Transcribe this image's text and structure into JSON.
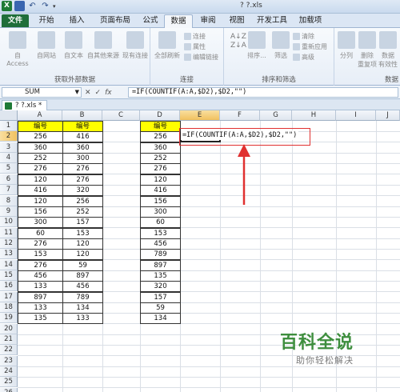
{
  "window": {
    "title": "? ?.xls"
  },
  "quick_access": {
    "logo": "X",
    "undo_glyph": "↶",
    "redo_glyph": "↷",
    "more_glyph": "▾"
  },
  "tabs": {
    "file": "文件",
    "items": [
      "开始",
      "插入",
      "页面布局",
      "公式",
      "数据",
      "审阅",
      "视图",
      "开发工具",
      "加载项"
    ],
    "active": "数据"
  },
  "ribbon": {
    "get_external": {
      "label": "获取外部数据",
      "buttons": [
        "自 Access",
        "自网站",
        "自文本",
        "自其他来源",
        "现有连接"
      ]
    },
    "connections": {
      "label": "连接",
      "refresh": "全部刷新",
      "small": [
        "连接",
        "属性",
        "编辑链接"
      ]
    },
    "sort_filter": {
      "label": "排序和筛选",
      "sort_az": "A↓Z\nZ↓A",
      "sort": "排序...",
      "filter": "筛选",
      "small": [
        "清除",
        "重新应用",
        "高级"
      ]
    },
    "data_tools": {
      "label": "数据",
      "buttons": [
        "分列",
        "删除\n重复项",
        "数据\n有效性"
      ]
    }
  },
  "formula_bar": {
    "name_box": "SUM",
    "name_drop": "▼",
    "controls": [
      "✕",
      "✓",
      "fx"
    ],
    "formula": "=IF(COUNTIF(A:A,$D2),$D2,\"\")"
  },
  "workbook_tab": {
    "label": "? ?.xls *"
  },
  "grid": {
    "columns": [
      "A",
      "B",
      "C",
      "D",
      "E",
      "F",
      "G",
      "H",
      "I",
      "J"
    ],
    "rows": [
      "1",
      "2",
      "3",
      "4",
      "5",
      "6",
      "7",
      "8",
      "9",
      "10",
      "11",
      "12",
      "13",
      "14",
      "15",
      "16",
      "17",
      "18",
      "19",
      "20",
      "21",
      "22",
      "23",
      "24",
      "25",
      "26"
    ],
    "header_a": "编号",
    "header_b": "编号",
    "header_d": "编号",
    "col_a": [
      "256",
      "360",
      "252",
      "276",
      "120",
      "416",
      "120",
      "156",
      "300",
      "60",
      "276",
      "153",
      "276",
      "456",
      "133",
      "897",
      "133",
      "135"
    ],
    "col_b": [
      "416",
      "360",
      "300",
      "276",
      "276",
      "320",
      "256",
      "252",
      "157",
      "153",
      "120",
      "120",
      "59",
      "897",
      "456",
      "789",
      "134",
      "133"
    ],
    "col_d": [
      "256",
      "360",
      "252",
      "276",
      "120",
      "416",
      "156",
      "300",
      "60",
      "153",
      "456",
      "789",
      "897",
      "135",
      "320",
      "157",
      "59",
      "134"
    ],
    "active_cell": "E2",
    "cell_formula": "=IF(COUNTIF(A:A,$D2),$D2,\"\")"
  },
  "watermark": {
    "title": "百科全说",
    "subtitle": "助你轻松解决"
  },
  "colors": {
    "header_fill": "#ffff00",
    "annotation": "#e03030",
    "brand": "#3e8e3e"
  }
}
